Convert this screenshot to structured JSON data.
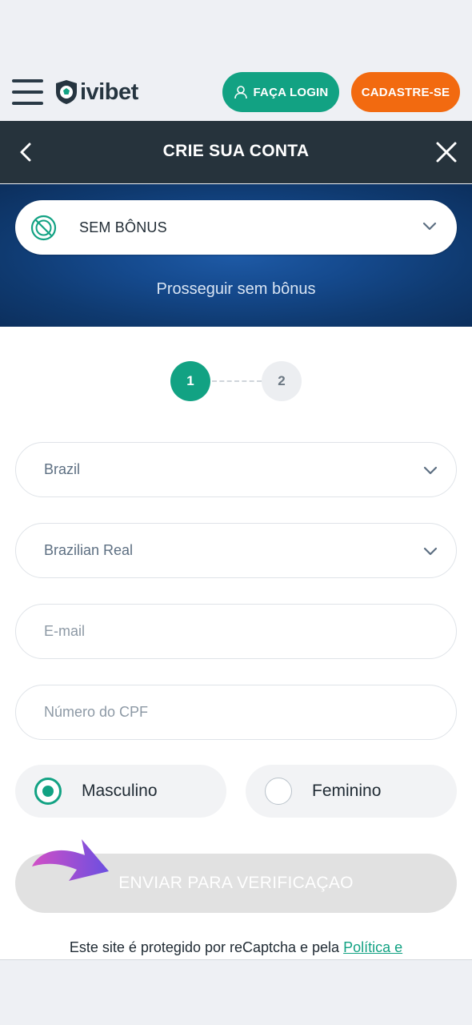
{
  "brand": {
    "name": "ivibet",
    "accent": "#12a283",
    "orange": "#f26a10"
  },
  "topbar": {
    "menu_icon": "hamburger-menu-icon",
    "login_label": "FAÇA LOGIN",
    "login_icon": "user-icon",
    "register_label": "CADASTRE-SE"
  },
  "header": {
    "title": "CRIE SUA CONTA",
    "back_icon": "chevron-left-icon",
    "close_icon": "close-icon"
  },
  "bonus": {
    "selected": "SEM BÔNUS",
    "icon": "no-bonus-icon",
    "subtitle": "Prosseguir sem bônus"
  },
  "steps": {
    "current": "1",
    "next": "2"
  },
  "form": {
    "country": "Brazil",
    "currency": "Brazilian Real",
    "email_placeholder": "E-mail",
    "cpf_placeholder": "Número do CPF",
    "gender_male": "Masculino",
    "gender_female": "Feminino",
    "gender_selected": "Masculino",
    "submit_label": "ENVIAR PARA VERIFICAÇAO"
  },
  "footer": {
    "recaptcha_text": "Este site é protegido por reCaptcha e pela ",
    "policy_link": "Política e"
  }
}
